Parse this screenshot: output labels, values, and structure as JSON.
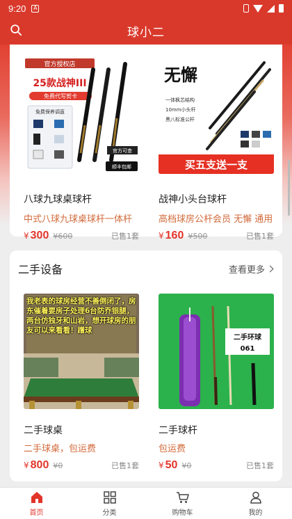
{
  "status_bar": {
    "time": "9:20",
    "notification": "A"
  },
  "header": {
    "title": "球小二",
    "search_icon": "search-icon"
  },
  "featured": {
    "products": [
      {
        "name": "八球九球桌球杆",
        "desc": "中式八球九球桌球杆一体杆",
        "yen": "¥",
        "price": "300",
        "orig": "¥600",
        "sold": "已售1套",
        "img": {
          "banner": "官方授权店",
          "headline": "25款战神III",
          "tag": "免费代写贺卡",
          "gift": "免费保养调直",
          "right_tag": "官方可查",
          "bottom_tag": "顺丰包邮"
        }
      },
      {
        "name": "战神小头台球杆",
        "desc": "高档球房公杆会员 无懈 通用",
        "yen": "¥",
        "price": "160",
        "orig": "¥500",
        "sold": "已售1套",
        "img": {
          "calligraphy": "无懈",
          "feature1": "一体枫芯结构",
          "feature2": "10mm小头杆",
          "feature3": "黑八标准公杆",
          "banner": "买五支送一支"
        }
      }
    ]
  },
  "secondhand": {
    "title": "二手设备",
    "more_label": "查看更多",
    "products": [
      {
        "name": "二手球桌",
        "desc": "二手球桌，包运费",
        "yen": "¥",
        "price": "800",
        "orig": "¥0",
        "sold": "已售1套",
        "img": {
          "overlay": "我老表的球房经营不善倒闭了，房东催着要房子处理6台防乔银腿，两台仿独牙和山岩，想开球房的朋友可以来看看！蹭球"
        }
      },
      {
        "name": "二手球杆",
        "desc": "包运费",
        "yen": "¥",
        "price": "50",
        "orig": "¥0",
        "sold": "已售1套",
        "img": {
          "label": "二手环球",
          "number": "061"
        }
      }
    ]
  },
  "tabbar": {
    "tabs": [
      {
        "label": "首页",
        "icon": "home-icon",
        "active": true
      },
      {
        "label": "分类",
        "icon": "grid-icon",
        "active": false
      },
      {
        "label": "购物车",
        "icon": "cart-icon",
        "active": false
      },
      {
        "label": "我的",
        "icon": "user-icon",
        "active": false
      }
    ]
  },
  "colors": {
    "brand": "#d9392b",
    "price": "#e2352a",
    "desc": "#d26a3a"
  }
}
